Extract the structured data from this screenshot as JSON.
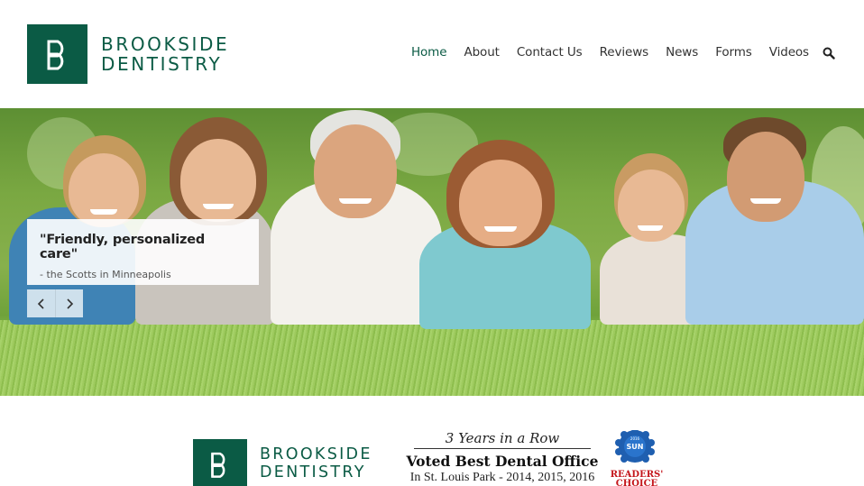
{
  "brand": {
    "line1": "BROOKSIDE",
    "line2": "DENTISTRY",
    "color": "#0b5b45",
    "mark": "DB"
  },
  "nav": {
    "items": [
      {
        "label": "Home",
        "active": true
      },
      {
        "label": "About"
      },
      {
        "label": "Contact Us"
      },
      {
        "label": "Reviews"
      },
      {
        "label": "News"
      },
      {
        "label": "Forms"
      },
      {
        "label": "Videos"
      }
    ],
    "search_icon": "search-icon"
  },
  "hero": {
    "quote": "\"Friendly, personalized care\"",
    "attribution": "- the Scotts in Minneapolis",
    "prev_icon": "chevron-left-icon",
    "next_icon": "chevron-right-icon"
  },
  "award": {
    "brand_line1": "BROOKSIDE",
    "brand_line2": "DENTISTRY",
    "years": "3 Years in a Row",
    "voted": "Voted Best Dental Office",
    "location": "In St. Louis Park - 2014, 2015, 2016",
    "ribbon_top": "2016",
    "ribbon_sun": "SUN",
    "ribbon_text1": "READERS'",
    "ribbon_text2": "CHOICE"
  }
}
